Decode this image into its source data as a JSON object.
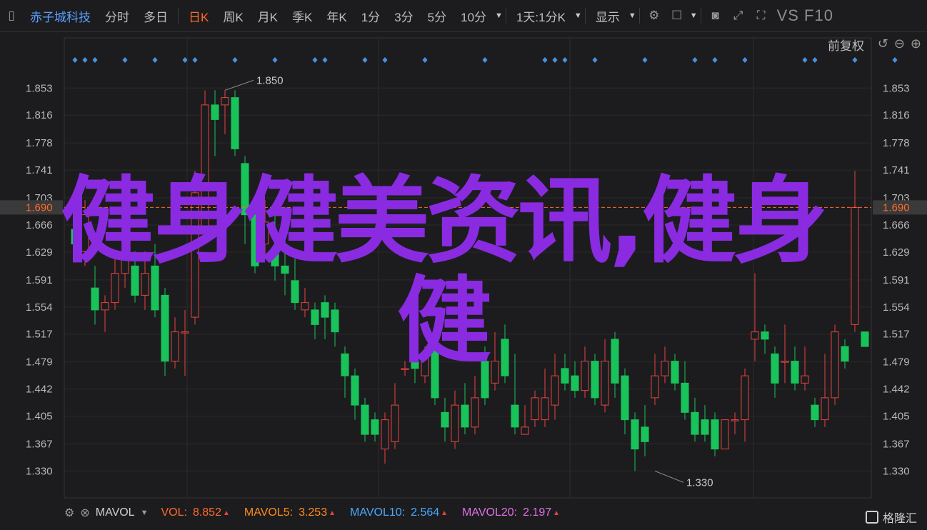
{
  "toolbar": {
    "stock_name": "赤子城科技",
    "periods": [
      "分时",
      "多日",
      "日K",
      "周K",
      "月K",
      "季K",
      "年K",
      "1分",
      "3分",
      "5分",
      "10分"
    ],
    "active_period": "日K",
    "range_selector": "1天:1分K",
    "display_label": "显示",
    "version_label": "VS F10"
  },
  "chart_header": {
    "adjust_label": "前复权"
  },
  "chart_data": {
    "type": "candlestick",
    "yaxis_ticks": [
      "1.853",
      "1.816",
      "1.778",
      "1.741",
      "1.703",
      "1.666",
      "1.629",
      "1.591",
      "1.554",
      "1.517",
      "1.479",
      "1.442",
      "1.405",
      "1.367",
      "1.330"
    ],
    "ylim": [
      1.305,
      1.905
    ],
    "current_price": "1.690",
    "annotations": [
      {
        "label": "1.850",
        "x_index": 15,
        "value": 1.85
      },
      {
        "label": "1.330",
        "x_index": 58,
        "value": 1.33
      }
    ],
    "candles": [
      [
        1.66,
        1.64,
        1.69,
        1.62
      ],
      [
        1.63,
        1.68,
        1.7,
        1.61
      ],
      [
        1.58,
        1.55,
        1.61,
        1.53
      ],
      [
        1.55,
        1.56,
        1.57,
        1.52
      ],
      [
        1.56,
        1.6,
        1.62,
        1.55
      ],
      [
        1.6,
        1.63,
        1.64,
        1.58
      ],
      [
        1.61,
        1.57,
        1.63,
        1.56
      ],
      [
        1.57,
        1.6,
        1.63,
        1.55
      ],
      [
        1.61,
        1.55,
        1.64,
        1.54
      ],
      [
        1.57,
        1.48,
        1.58,
        1.46
      ],
      [
        1.48,
        1.52,
        1.54,
        1.47
      ],
      [
        1.52,
        1.52,
        1.55,
        1.46
      ],
      [
        1.54,
        1.71,
        1.74,
        1.53
      ],
      [
        1.66,
        1.83,
        1.85,
        1.65
      ],
      [
        1.83,
        1.81,
        1.85,
        1.76
      ],
      [
        1.83,
        1.84,
        1.85,
        1.79
      ],
      [
        1.84,
        1.77,
        1.85,
        1.76
      ],
      [
        1.75,
        1.68,
        1.76,
        1.64
      ],
      [
        1.68,
        1.61,
        1.7,
        1.6
      ],
      [
        1.64,
        1.67,
        1.7,
        1.62
      ],
      [
        1.63,
        1.61,
        1.68,
        1.59
      ],
      [
        1.61,
        1.6,
        1.65,
        1.57
      ],
      [
        1.59,
        1.56,
        1.62,
        1.55
      ],
      [
        1.55,
        1.56,
        1.58,
        1.54
      ],
      [
        1.55,
        1.53,
        1.56,
        1.51
      ],
      [
        1.56,
        1.54,
        1.57,
        1.51
      ],
      [
        1.55,
        1.52,
        1.56,
        1.5
      ],
      [
        1.49,
        1.46,
        1.5,
        1.43
      ],
      [
        1.46,
        1.42,
        1.47,
        1.4
      ],
      [
        1.42,
        1.38,
        1.43,
        1.37
      ],
      [
        1.4,
        1.38,
        1.41,
        1.37
      ],
      [
        1.36,
        1.4,
        1.41,
        1.34
      ],
      [
        1.37,
        1.42,
        1.45,
        1.36
      ],
      [
        1.47,
        1.47,
        1.48,
        1.46
      ],
      [
        1.48,
        1.47,
        1.49,
        1.45
      ],
      [
        1.46,
        1.49,
        1.5,
        1.45
      ],
      [
        1.5,
        1.43,
        1.51,
        1.42
      ],
      [
        1.41,
        1.39,
        1.43,
        1.37
      ],
      [
        1.37,
        1.42,
        1.44,
        1.36
      ],
      [
        1.42,
        1.39,
        1.45,
        1.38
      ],
      [
        1.39,
        1.43,
        1.46,
        1.38
      ],
      [
        1.48,
        1.43,
        1.5,
        1.42
      ],
      [
        1.45,
        1.48,
        1.52,
        1.44
      ],
      [
        1.51,
        1.46,
        1.53,
        1.45
      ],
      [
        1.42,
        1.39,
        1.49,
        1.38
      ],
      [
        1.38,
        1.39,
        1.42,
        1.38
      ],
      [
        1.4,
        1.43,
        1.44,
        1.39
      ],
      [
        1.4,
        1.43,
        1.47,
        1.39
      ],
      [
        1.42,
        1.46,
        1.49,
        1.4
      ],
      [
        1.47,
        1.45,
        1.49,
        1.44
      ],
      [
        1.46,
        1.44,
        1.48,
        1.43
      ],
      [
        1.44,
        1.48,
        1.5,
        1.43
      ],
      [
        1.48,
        1.43,
        1.49,
        1.42
      ],
      [
        1.42,
        1.48,
        1.51,
        1.41
      ],
      [
        1.51,
        1.45,
        1.52,
        1.43
      ],
      [
        1.46,
        1.4,
        1.47,
        1.38
      ],
      [
        1.4,
        1.36,
        1.41,
        1.33
      ],
      [
        1.39,
        1.37,
        1.42,
        1.35
      ],
      [
        1.43,
        1.46,
        1.49,
        1.42
      ],
      [
        1.46,
        1.48,
        1.5,
        1.45
      ],
      [
        1.48,
        1.45,
        1.49,
        1.44
      ],
      [
        1.45,
        1.41,
        1.48,
        1.4
      ],
      [
        1.41,
        1.38,
        1.43,
        1.37
      ],
      [
        1.4,
        1.38,
        1.42,
        1.37
      ],
      [
        1.4,
        1.36,
        1.41,
        1.35
      ],
      [
        1.36,
        1.4,
        1.4,
        1.36
      ],
      [
        1.4,
        1.4,
        1.41,
        1.38
      ],
      [
        1.4,
        1.46,
        1.47,
        1.37
      ],
      [
        1.51,
        1.52,
        1.6,
        1.48
      ],
      [
        1.52,
        1.51,
        1.53,
        1.49
      ],
      [
        1.49,
        1.45,
        1.5,
        1.43
      ],
      [
        1.48,
        1.48,
        1.53,
        1.45
      ],
      [
        1.48,
        1.45,
        1.5,
        1.44
      ],
      [
        1.45,
        1.46,
        1.5,
        1.44
      ],
      [
        1.42,
        1.4,
        1.43,
        1.39
      ],
      [
        1.4,
        1.43,
        1.49,
        1.39
      ],
      [
        1.43,
        1.52,
        1.53,
        1.42
      ],
      [
        1.5,
        1.48,
        1.51,
        1.47
      ],
      [
        1.53,
        1.69,
        1.74,
        1.52
      ],
      [
        1.52,
        1.5,
        1.52,
        1.5
      ]
    ]
  },
  "signal_markers_x": [
    0,
    1,
    2,
    5,
    8,
    11,
    12,
    16,
    20,
    24,
    25,
    29,
    31,
    35,
    41,
    47,
    48,
    49,
    52,
    57,
    62,
    64,
    67,
    73,
    74,
    78,
    82
  ],
  "indicators": {
    "name": "MAVOL",
    "vol_label": "VOL:",
    "vol_value": "8.852",
    "mavol5_label": "MAVOL5:",
    "mavol5_value": "3.253",
    "mavol10_label": "MAVOL10:",
    "mavol10_value": "2.564",
    "mavol20_label": "MAVOL20:",
    "mavol20_value": "2.197",
    "colors": {
      "vol": "#ff6a2b",
      "mavol5": "#ff8c1a",
      "mavol10": "#4aa8ff",
      "mavol20": "#e070e8"
    }
  },
  "watermark_text": "健身健美资讯,健身健",
  "logo_text": "格隆汇",
  "colors": {
    "up": "#e8423f",
    "down": "#18c35a",
    "price_line": "#ff6a2b",
    "marker": "#4a90e2"
  }
}
